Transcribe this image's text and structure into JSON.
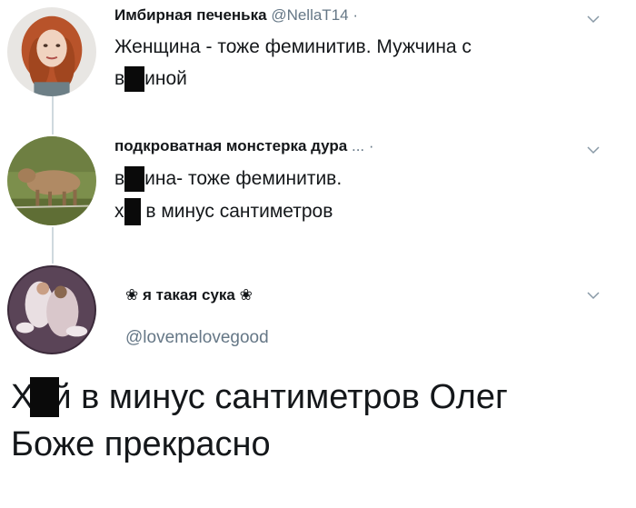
{
  "tweets": [
    {
      "name": "Имбирная печенька",
      "handle": "@NellaT14",
      "dot": "·",
      "lines": [
        {
          "pre": "",
          "post": "Женщина - тоже феминитив. Мужчина с"
        },
        {
          "pre": "в",
          "post": "иной"
        }
      ]
    },
    {
      "name": "подкроватная монстерка дура",
      "ellipsis": "...",
      "dot": "·",
      "lines": [
        {
          "pre": "в",
          "post": "ина- тоже феминитив."
        },
        {
          "pre": "х",
          "post": " в минус сантиметров"
        }
      ]
    }
  ],
  "reply": {
    "flower_left": "❀",
    "name": "я такая сука",
    "flower_right": "❀",
    "handle": "@lovemelovegood",
    "text_line1_pre": "Х",
    "text_line1_post": "й в минус сантиметров Олег",
    "text_line2": "Боже прекрасно"
  },
  "icons": {
    "chevron": "chevron-down-icon"
  },
  "colors": {
    "text": "#14171a",
    "secondary": "#657786",
    "thread_line": "#cfd9de",
    "censor": "#0a0a0a"
  }
}
